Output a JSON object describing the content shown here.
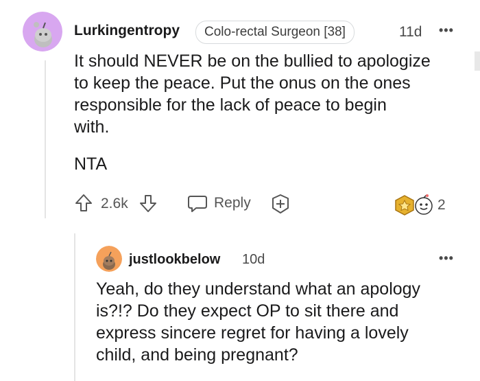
{
  "comment": {
    "username": "Lurkingentropy",
    "flair": "Colo-rectal Surgeon [38]",
    "age": "11d",
    "more_icon": "more-dots-icon",
    "body_lines": [
      "It should NEVER be on the bullied to apologize",
      "to keep the peace. Put the onus on the ones",
      "responsible for the lack of peace to begin",
      "with."
    ],
    "body_line2": "NTA",
    "votes": "2.6k",
    "reply_label": "Reply",
    "award_count": "2",
    "avatar_color": "#d8a7f0"
  },
  "reply": {
    "username": "justlookbelow",
    "age": "10d",
    "body_lines": [
      "Yeah, do they understand what an apology",
      "is?!? Do they expect OP to sit there and",
      "express sincere regret for having a lovely",
      "child, and being pregnant?"
    ],
    "avatar_color": "#f5a15b"
  }
}
